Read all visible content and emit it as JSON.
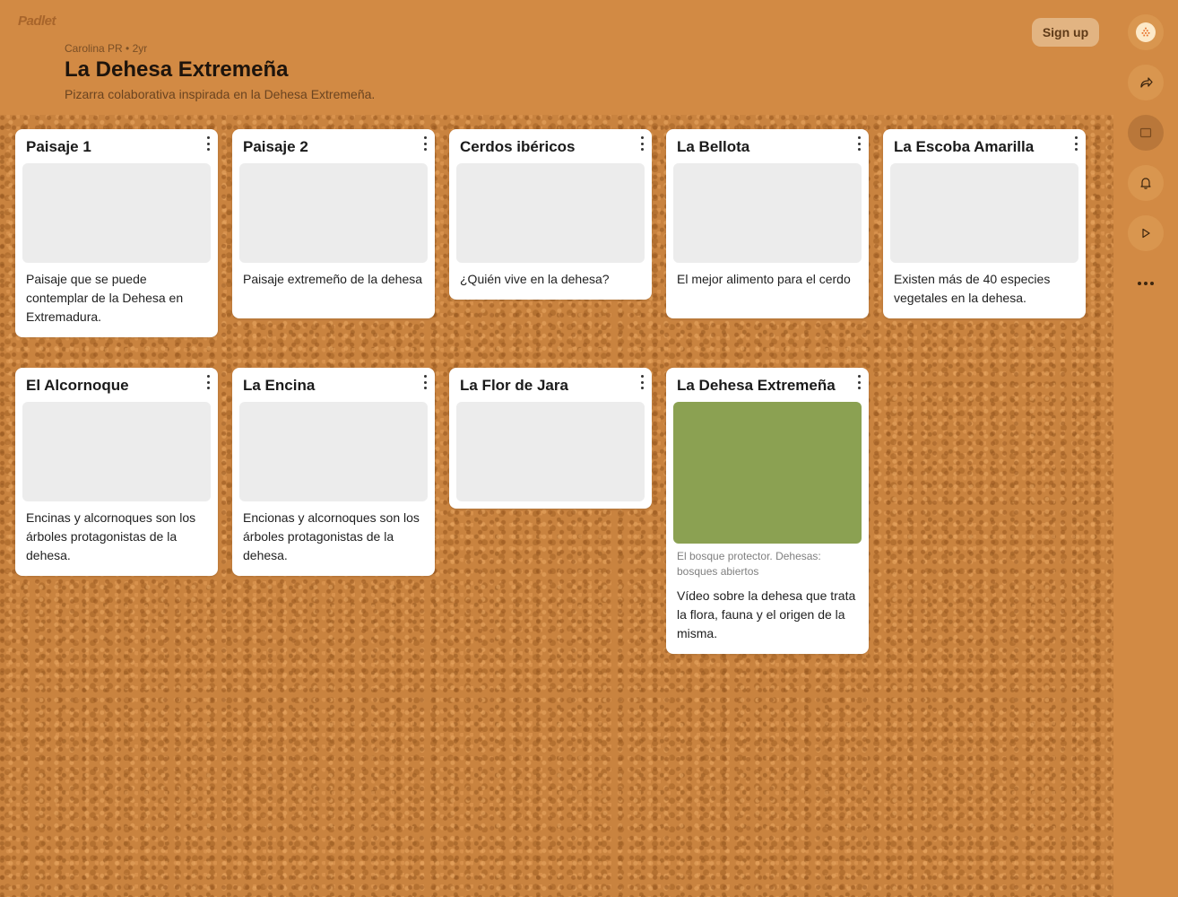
{
  "app": {
    "logo": "Padlet"
  },
  "header": {
    "author_meta": "Carolina PR • 2yr",
    "title": "La Dehesa Extremeña",
    "subtitle": "Pizarra colaborativa inspirada en la Dehesa Extremeña.",
    "signup_label": "Sign up"
  },
  "rail": {
    "icons": [
      "avatar-icon",
      "share-icon",
      "remake-icon",
      "bell-icon",
      "play-icon",
      "more-icon"
    ]
  },
  "cards": [
    {
      "title": "Paisaje 1",
      "body": "Paisaje que se puede contemplar de la Dehesa en Extremadura."
    },
    {
      "title": "Paisaje 2",
      "body": "Paisaje extremeño de la dehesa"
    },
    {
      "title": "Cerdos ibéricos",
      "body": "¿Quién vive en la dehesa?"
    },
    {
      "title": "La Bellota",
      "body": "El mejor alimento para el cerdo"
    },
    {
      "title": "La Escoba Amarilla",
      "body": "Existen más de 40 especies vegetales en la dehesa."
    },
    {
      "title": "El Alcornoque",
      "body": "Encinas y alcornoques son los árboles protagonistas de la dehesa."
    },
    {
      "title": "La Encina",
      "body": "Encionas y alcornoques son los árboles protagonistas de la dehesa."
    },
    {
      "title": "La Flor de Jara",
      "body": ""
    },
    {
      "title": "La Dehesa Extremeña",
      "caption": "El bosque protector. Dehesas: bosques abiertos",
      "body": "Vídeo sobre la dehesa que trata la flora, fauna y el origen de la misma.",
      "thumb_color": "#8ba152"
    }
  ],
  "colors": {
    "background": "#d28a44",
    "card": "#ffffff",
    "thumb_placeholder": "#ececec"
  }
}
